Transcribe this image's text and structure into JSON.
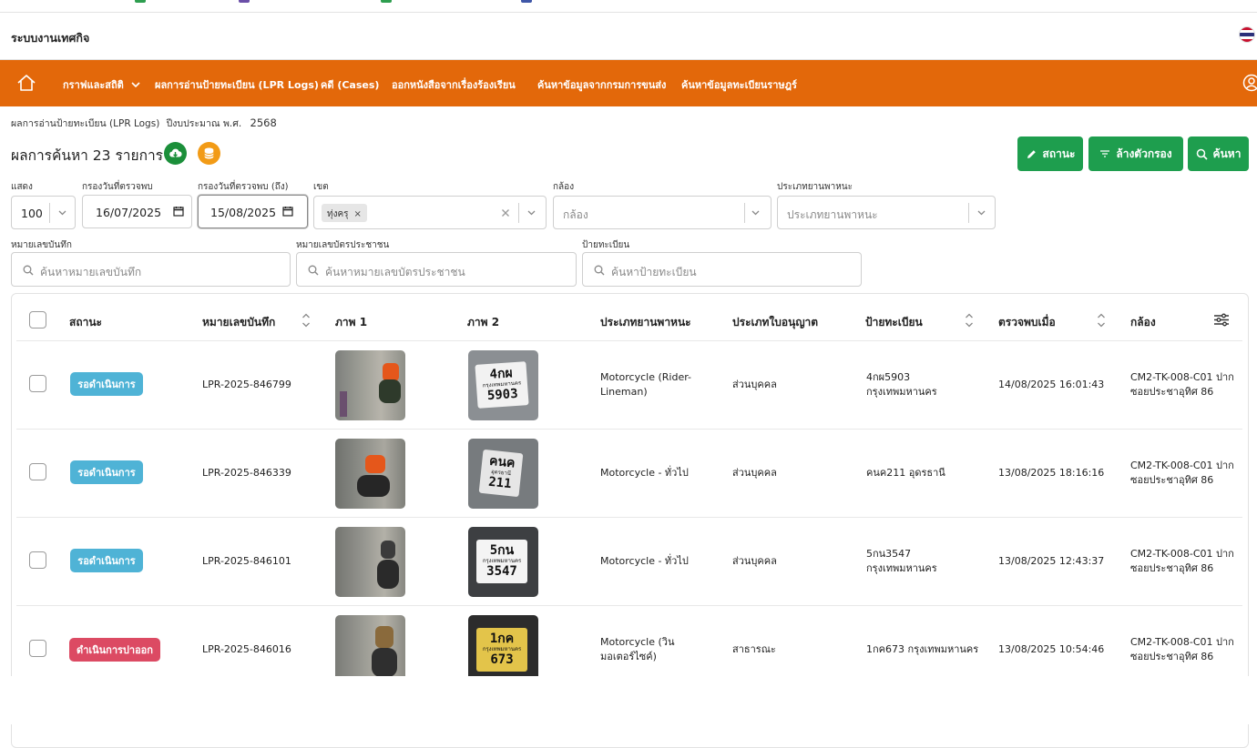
{
  "app": {
    "title": "ระบบงานเทศกิจ"
  },
  "colors": {
    "accent": "#e3680a",
    "success": "#1e9e4e",
    "pending": "#4fb3d6",
    "danger": "#dc4a63",
    "icon_round_1": "#1b8f3a",
    "icon_round_2": "#f29b16"
  },
  "nav": {
    "items": [
      {
        "label": "กราฟและสถิติ",
        "dropdown": true
      },
      {
        "label": "ผลการอ่านป้ายทะเบียน (LPR Logs)"
      },
      {
        "label": "คดี (Cases)"
      },
      {
        "label": "ออกหนังสือจากเรื่องร้องเรียน"
      },
      {
        "label": "ค้นหาข้อมูลจากกรมการขนส่ง"
      },
      {
        "label": "ค้นหาข้อมูลทะเบียนราษฎร์"
      }
    ]
  },
  "breadcrumb": {
    "page": "ผลการอ่านป้ายทะเบียน (LPR Logs)",
    "fiscal_label": "ปีงบประมาณ พ.ศ.",
    "fiscal_year": "2568"
  },
  "results": {
    "title": "ผลการค้นหา 23 รายการ"
  },
  "buttons": {
    "status": "สถานะ",
    "clear_filters": "ล้างตัวกรอง",
    "search": "ค้นหา"
  },
  "filters": {
    "show_label": "แสดง",
    "show_value": "100",
    "date_from_label": "กรองวันที่ตรวจพบ",
    "date_from": "16/07/2025",
    "date_to_label": "กรองวันที่ตรวจพบ (ถึง)",
    "date_to": "15/08/2025",
    "district_label": "เขต",
    "district_tag": "ทุ่งครุ",
    "camera_label": "กล้อง",
    "camera_placeholder": "กล้อง",
    "vehicle_type_label": "ประเภทยานพาหนะ",
    "vehicle_type_placeholder": "ประเภทยานพาหนะ",
    "record_no_label": "หมายเลขบันทึก",
    "record_no_placeholder": "ค้นหาหมายเลขบันทึก",
    "citizen_id_label": "หมายเลขบัตรประชาชน",
    "citizen_id_placeholder": "ค้นหาหมายเลขบัตรประชาชน",
    "plate_label": "ป้ายทะเบียน",
    "plate_placeholder": "ค้นหาป้ายทะเบียน"
  },
  "table": {
    "headers": {
      "status": "สถานะ",
      "record_no": "หมายเลขบันทึก",
      "image1": "ภาพ 1",
      "image2": "ภาพ 2",
      "vehicle_type": "ประเภทยานพาหนะ",
      "license_type": "ประเภทใบอนุญาต",
      "plate": "ป้ายทะเบียน",
      "detected_at": "ตรวจพบเมื่อ",
      "camera": "กล้อง"
    },
    "rows": [
      {
        "status": "รอดำเนินการ",
        "status_kind": "pending",
        "record_no": "LPR-2025-846799",
        "vehicle_type": "Motorcycle (Rider-Lineman)",
        "license_type": "ส่วนบุคคล",
        "plate": "4กผ5903 กรุงเทพมหานคร",
        "detected_at": "14/08/2025 16:01:43",
        "camera": "CM2-TK-008-C01 ปากซอยประชาอุทิศ 86",
        "plate_img": {
          "l1": "4กผ",
          "l2": "กรุงเทพมหานคร",
          "l3": "5903"
        }
      },
      {
        "status": "รอดำเนินการ",
        "status_kind": "pending",
        "record_no": "LPR-2025-846339",
        "vehicle_type": "Motorcycle - ทั่วไป",
        "license_type": "ส่วนบุคคล",
        "plate": "คนค211 อุดรธานี",
        "detected_at": "13/08/2025 18:16:16",
        "camera": "CM2-TK-008-C01 ปากซอยประชาอุทิศ 86",
        "plate_img": {
          "l1": "คนค",
          "l2": "อุดรธานี",
          "l3": "211"
        }
      },
      {
        "status": "รอดำเนินการ",
        "status_kind": "pending",
        "record_no": "LPR-2025-846101",
        "vehicle_type": "Motorcycle - ทั่วไป",
        "license_type": "ส่วนบุคคล",
        "plate": "5กน3547 กรุงเทพมหานคร",
        "detected_at": "13/08/2025 12:43:37",
        "camera": "CM2-TK-008-C01 ปากซอยประชาอุทิศ 86",
        "plate_img": {
          "l1": "5กน",
          "l2": "กรุงเทพมหานคร",
          "l3": "3547"
        }
      },
      {
        "status": "ดำเนินการปาออก",
        "status_kind": "danger",
        "record_no": "LPR-2025-846016",
        "vehicle_type": "Motorcycle (วินมอเตอร์ไซค์)",
        "license_type": "สาธารณะ",
        "plate": "1กค673 กรุงเทพมหานคร",
        "detected_at": "13/08/2025 10:54:46",
        "camera": "CM2-TK-008-C01 ปากซอยประชาอุทิศ 86",
        "plate_img": {
          "l1": "1กค",
          "l2": "กรุงเทพมหานคร",
          "l3": "673"
        }
      }
    ]
  }
}
